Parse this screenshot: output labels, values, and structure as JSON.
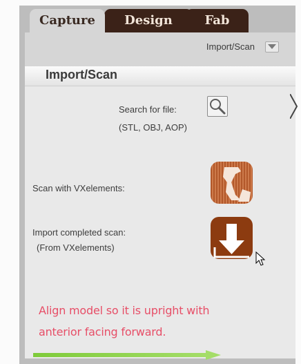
{
  "tabs": {
    "capture": "Capture",
    "design": "Design",
    "fab": "Fab"
  },
  "dropdown": {
    "label": "Import/Scan"
  },
  "panel": {
    "title": "Import/Scan",
    "search_label": "Search for file:",
    "search_formats": "(STL, OBJ, AOP)",
    "scan_label": "Scan with VXelements:",
    "import_label": "Import completed scan:",
    "import_sub": "(From VXelements)",
    "note_line1": "Align model so it is upright with",
    "note_line2": "anterior facing forward."
  },
  "colors": {
    "tab_dark": "#3b2218",
    "button_brown": "#8c3b10",
    "note_red": "#e74e67",
    "arrow_green": "#8ed04a"
  },
  "icons": [
    "chevron-down-icon",
    "magnifier-icon",
    "scanner-icon",
    "import-arrow-icon",
    "cursor-icon",
    "arrow-right-icon"
  ]
}
